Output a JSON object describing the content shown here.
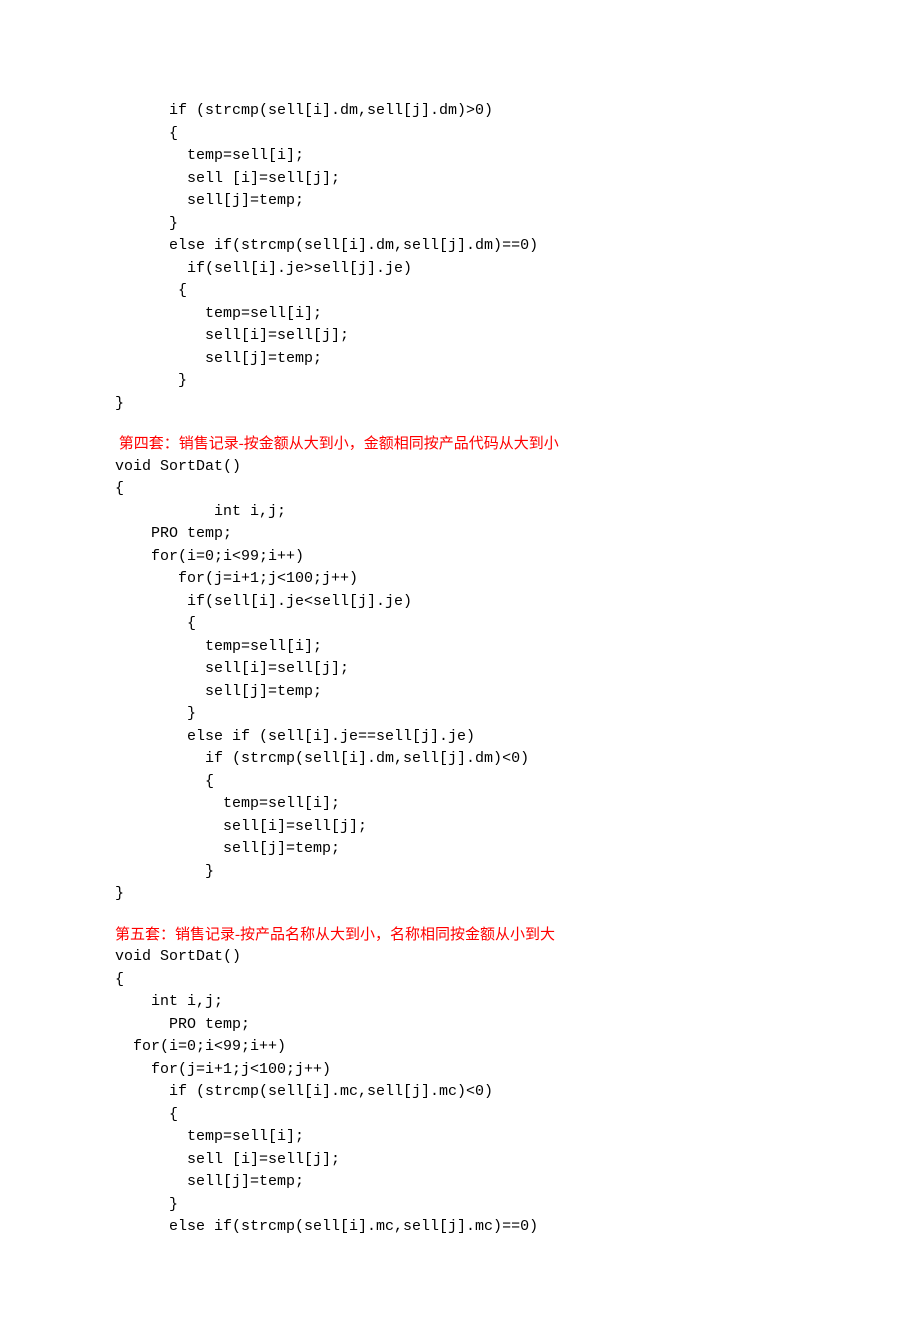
{
  "section1": {
    "code": "      if (strcmp(sell[i].dm,sell[j].dm)>0)\n      {\n        temp=sell[i];\n        sell [i]=sell[j];\n        sell[j]=temp;\n      }\n      else if(strcmp(sell[i].dm,sell[j].dm)==0)\n        if(sell[i].je>sell[j].je)\n       {\n          temp=sell[i];\n          sell[i]=sell[j];\n          sell[j]=temp;\n       }\n}"
  },
  "section2": {
    "heading": " 第四套：销售记录-按金额从大到小，金额相同按产品代码从大到小",
    "code": "void SortDat()\n{\n           int i,j;\n    PRO temp;\n    for(i=0;i<99;i++)\n       for(j=i+1;j<100;j++)\n        if(sell[i].je<sell[j].je)\n        {\n          temp=sell[i];\n          sell[i]=sell[j];\n          sell[j]=temp;\n        }\n        else if (sell[i].je==sell[j].je)\n          if (strcmp(sell[i].dm,sell[j].dm)<0)\n          {\n            temp=sell[i];\n            sell[i]=sell[j];\n            sell[j]=temp;\n          }\n}"
  },
  "section3": {
    "heading": "第五套：销售记录-按产品名称从大到小，名称相同按金额从小到大",
    "code": "void SortDat()\n{\n    int i,j;\n      PRO temp;\n  for(i=0;i<99;i++)\n    for(j=i+1;j<100;j++)\n      if (strcmp(sell[i].mc,sell[j].mc)<0)\n      {\n        temp=sell[i];\n        sell [i]=sell[j];\n        sell[j]=temp;\n      }\n      else if(strcmp(sell[i].mc,sell[j].mc)==0)"
  }
}
